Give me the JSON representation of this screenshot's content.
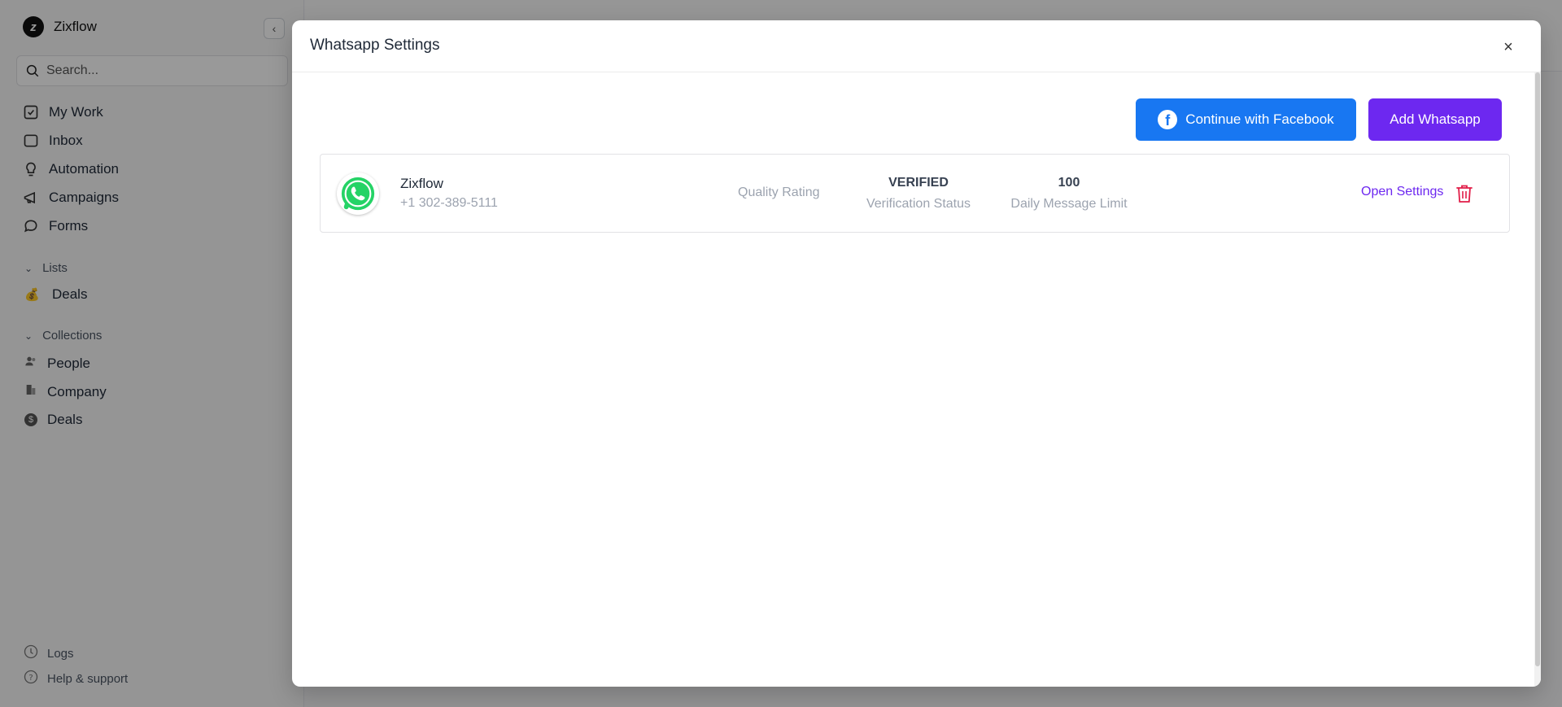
{
  "app": {
    "name": "Zixflow"
  },
  "sidebar": {
    "search_placeholder": "Search...",
    "nav": [
      {
        "label": "My Work",
        "icon": "check-square-icon"
      },
      {
        "label": "Inbox",
        "icon": "inbox-icon"
      },
      {
        "label": "Automation",
        "icon": "bulb-icon"
      },
      {
        "label": "Campaigns",
        "icon": "megaphone-icon"
      },
      {
        "label": "Forms",
        "icon": "chat-bubble-icon"
      }
    ],
    "lists": {
      "label": "Lists",
      "items": [
        {
          "label": "Deals",
          "icon": "money-bag-icon"
        }
      ]
    },
    "collections": {
      "label": "Collections",
      "items": [
        {
          "label": "People",
          "icon": "people-icon"
        },
        {
          "label": "Company",
          "icon": "building-icon"
        },
        {
          "label": "Deals",
          "icon": "dollar-icon"
        }
      ]
    },
    "footer": [
      {
        "label": "Logs",
        "icon": "clock-icon"
      },
      {
        "label": "Help & support",
        "icon": "help-icon"
      }
    ]
  },
  "modal": {
    "title": "Whatsapp Settings",
    "close_label": "×",
    "facebook_button": "Continue with Facebook",
    "add_button": "Add Whatsapp",
    "account": {
      "name": "Zixflow",
      "phone": "+1 302-389-5111",
      "quality_label": "Quality Rating",
      "verification_value": "VERIFIED",
      "verification_label": "Verification Status",
      "limit_value": "100",
      "limit_label": "Daily Message Limit",
      "open_settings": "Open Settings"
    }
  },
  "colors": {
    "facebook": "#1877f2",
    "primary": "#6d28f0",
    "whatsapp": "#25d366",
    "danger": "#e11d48"
  }
}
